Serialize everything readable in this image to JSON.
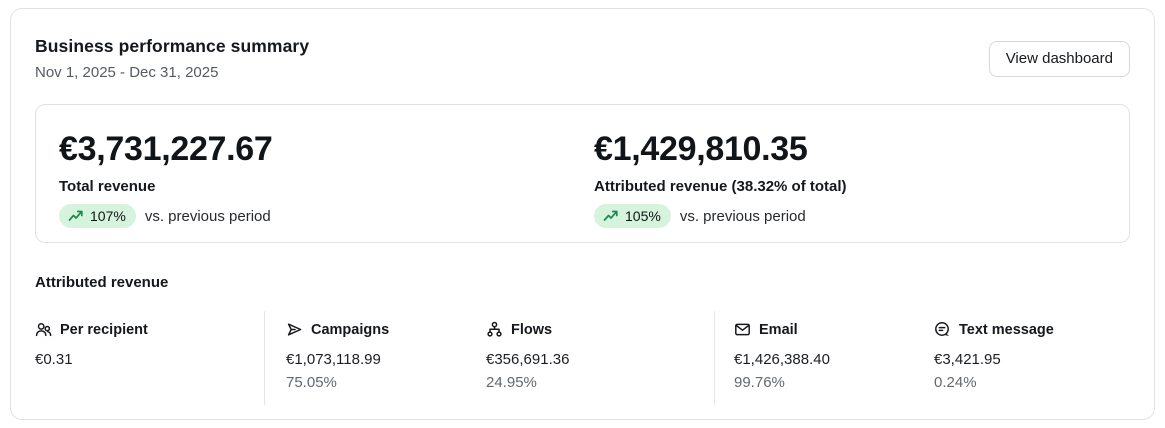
{
  "header": {
    "title": "Business performance summary",
    "date_range": "Nov 1, 2025 - Dec 31, 2025",
    "view_dashboard_label": "View dashboard"
  },
  "summary_card": {
    "metrics": [
      {
        "value": "€3,731,227.67",
        "label": "Total revenue",
        "change_percent": "107%",
        "comparison_label": "vs. previous period"
      },
      {
        "value": "€1,429,810.35",
        "label": "Attributed revenue (38.32% of total)",
        "change_percent": "105%",
        "comparison_label": "vs. previous period"
      }
    ]
  },
  "attributed_revenue": {
    "heading": "Attributed revenue",
    "columns": [
      {
        "icon": "users-icon",
        "label": "Per recipient",
        "value": "€0.31",
        "percent": ""
      },
      {
        "icon": "send-icon",
        "label": "Campaigns",
        "value": "€1,073,118.99",
        "percent": "75.05%"
      },
      {
        "icon": "hierarchy-icon",
        "label": "Flows",
        "value": "€356,691.36",
        "percent": "24.95%"
      },
      {
        "icon": "envelope-icon",
        "label": "Email",
        "value": "€1,426,388.40",
        "percent": "99.76%"
      },
      {
        "icon": "chat-bubble-icon",
        "label": "Text message",
        "value": "€3,421.95",
        "percent": "0.24%"
      }
    ]
  },
  "colors": {
    "badge_background": "#d6f3de",
    "badge_arrow_green": "#1d8a4d",
    "card_border": "#dfe3e8",
    "text_primary": "#15181c",
    "text_secondary": "#62686f"
  }
}
